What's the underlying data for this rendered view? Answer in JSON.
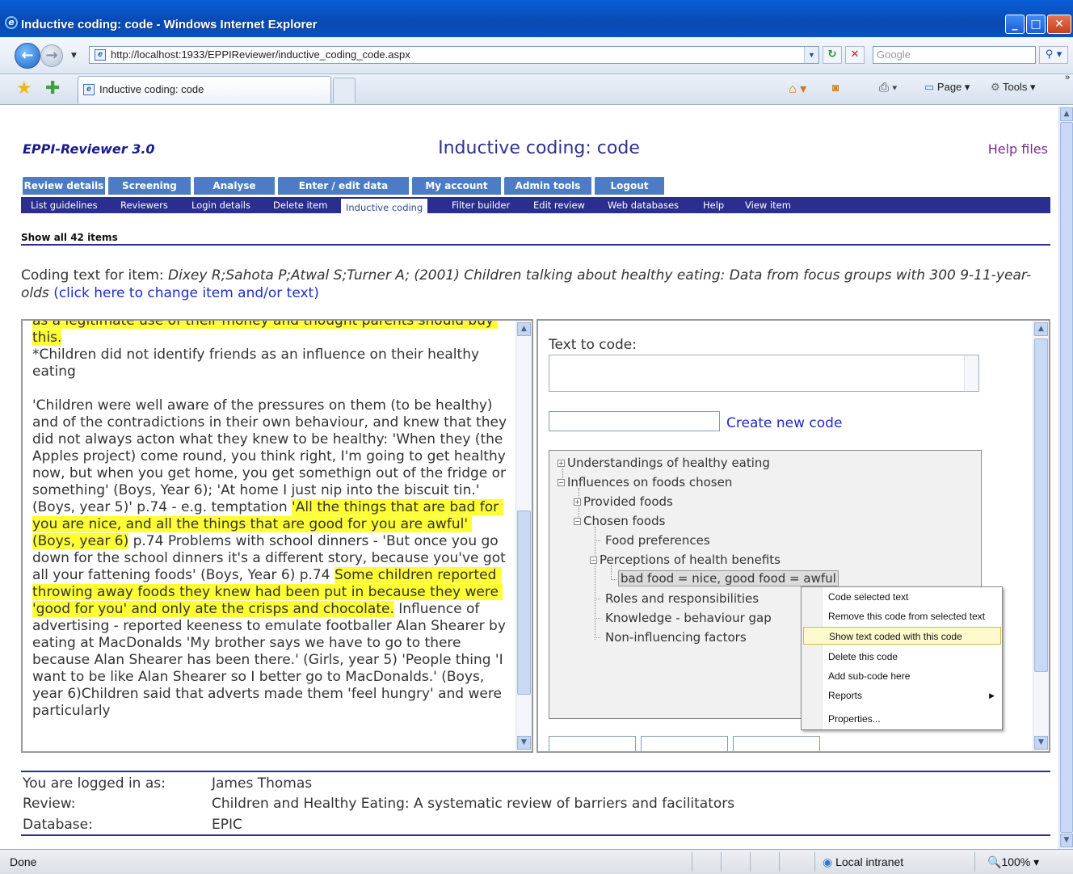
{
  "window": {
    "title": "Inductive coding: code - Windows Internet Explorer",
    "url": "http://localhost:1933/EPPIReviewer/inductive_coding_code.aspx",
    "search_placeholder": "Google",
    "tab_title": "Inductive coding: code",
    "tools": {
      "page": "Page",
      "tools": "Tools"
    }
  },
  "header": {
    "brand": "EPPI-Reviewer 3.0",
    "page_title": "Inductive coding: code",
    "help_link": "Help files"
  },
  "main_tabs": [
    "Review details",
    "Screening",
    "Analyse",
    "Enter / edit data",
    "My account",
    "Admin tools",
    "Logout"
  ],
  "sub_tabs": [
    "List guidelines",
    "Reviewers",
    "Login details",
    "Delete item",
    "Inductive coding",
    "Filter builder",
    "Edit review",
    "Web databases",
    "Help",
    "View item"
  ],
  "active_sub_tab": "Inductive coding",
  "show_all": "Show all 42 items",
  "coding_text": {
    "prefix": "Coding text for item: ",
    "citation": "Dixey R;Sahota P;Atwal S;Turner A; (2001) Children talking about healthy eating: Data from focus groups with 300 9-11-year-olds",
    "change_link": "(click here to change item and/or text)"
  },
  "document": {
    "segments": [
      {
        "text": "as a legitimate use of their money and thought parents should buy this.",
        "highlight": true
      },
      {
        "text": "\n*Children did not identify friends as an influence on their healthy eating\n\n'Children were well aware of the pressures on them (to be healthy) and of the contradictions in their own behaviour, and knew that they did not always acton what they knew to be healthy: 'When they (the Apples project) come round, you think right, I'm going to get healthy now, but when you get home, you get somethign out of the fridge or something' (Boys, Year 6); 'At home I just nip into the biscuit tin.' (Boys, year 5)' p.74 - e.g. temptation ",
        "highlight": false
      },
      {
        "text": "'All the things that are bad for you are nice, and all the things that are good for you are awful' (Boys, year 6)",
        "highlight": true
      },
      {
        "text": " p.74 Problems with school dinners - 'But once you go down for the school dinners it's a different story, because you've got all your fattening foods' (Boys, Year 6) p.74 ",
        "highlight": false
      },
      {
        "text": "Some children reported throwing away foods they knew had been put in because they were 'good for you' and only ate the crisps and chocolate.",
        "highlight": true
      },
      {
        "text": " Influence of advertising - reported keeness to emulate footballer Alan Shearer by eating at MacDonalds 'My brother says we have to go to there because Alan Shearer has been there.' (Girls, year 5) 'People thing 'I want to be like Alan Shearer so I better go to MacDonalds.' (Boys, year 6)Children said that adverts made them 'feel hungry' and were particularly",
        "highlight": false
      }
    ]
  },
  "coding_panel": {
    "text_to_code_label": "Text to code:",
    "text_to_code_value": "",
    "new_code_value": "",
    "create_link": "Create new code"
  },
  "tree": {
    "n1": "Understandings of healthy eating",
    "n2": "Influences on foods chosen",
    "n3": "Provided foods",
    "n4": "Chosen foods",
    "n5": "Food preferences",
    "n6": "Perceptions of health benefits",
    "n7": "bad food = nice, good food = awful",
    "n8": "Roles and responsibilities",
    "n9": "Knowledge - behaviour gap",
    "n10": "Non-influencing factors"
  },
  "context_menu": {
    "items": [
      "Code selected text",
      "Remove this code from selected text",
      "Show text coded with this code",
      "Delete this code",
      "Add sub-code here",
      "Reports",
      "Properties..."
    ],
    "active": "Show text coded with this code"
  },
  "footer": {
    "logged_in_label": "You are logged in as:",
    "logged_in_value": "James Thomas",
    "review_label": "Review:",
    "review_value": "Children and Healthy Eating: A systematic review of barriers and facilitators",
    "database_label": "Database:",
    "database_value": "EPIC"
  },
  "status": {
    "left": "Done",
    "zone": "Local intranet",
    "zoom": "100%"
  },
  "colors": {
    "tab_blue": "#4d7cc4",
    "nav_navy": "#2b2e8e",
    "highlight": "#ffff33",
    "link": "#1d2ec7"
  }
}
